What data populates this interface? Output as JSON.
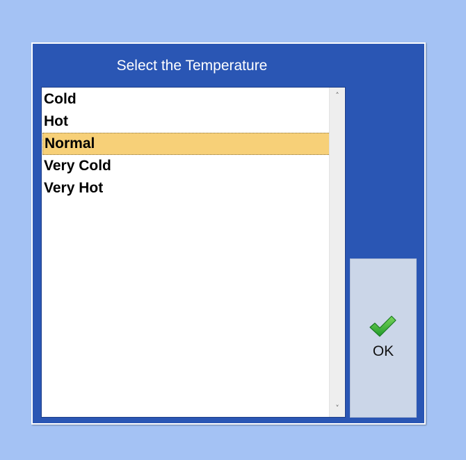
{
  "dialog": {
    "title": "Select the Temperature",
    "list": {
      "items": [
        {
          "label": "Cold",
          "selected": false
        },
        {
          "label": "Hot",
          "selected": false
        },
        {
          "label": "Normal",
          "selected": true
        },
        {
          "label": "Very Cold",
          "selected": false
        },
        {
          "label": "Very Hot",
          "selected": false
        }
      ],
      "scroll_up_icon": "chevron-up-icon",
      "scroll_down_icon": "chevron-down-icon"
    },
    "ok_button": {
      "label": "OK",
      "icon": "checkmark-icon"
    }
  },
  "colors": {
    "backdrop": "#a4c2f4",
    "dialog_background": "#2a56b4",
    "selection_highlight": "#f7d078",
    "checkmark": "#3bb53b"
  }
}
